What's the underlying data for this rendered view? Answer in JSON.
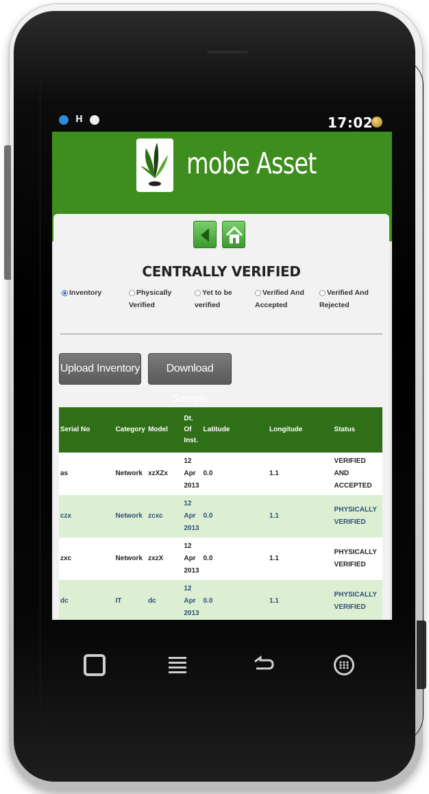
{
  "status_bar": {
    "time": "17:02",
    "icons": [
      "globe-icon",
      "h-signal-icon",
      "notification-icon",
      "battery-icon"
    ]
  },
  "app": {
    "title": "mobe Asset",
    "brand_color": "#3e8e1f"
  },
  "nav": {
    "back_icon": "back-arrow-icon",
    "home_icon": "home-icon"
  },
  "page_title": "CENTRALLY VERIFIED",
  "filters": [
    {
      "label": "Inventory",
      "checked": true
    },
    {
      "label": "Physically Verified",
      "checked": false
    },
    {
      "label": "Yet to be verified",
      "checked": false
    },
    {
      "label": "Verified And Accepted",
      "checked": false
    },
    {
      "label": "Verified And Rejected",
      "checked": false
    }
  ],
  "buttons": {
    "upload": "Upload Inventory",
    "download": "Download Sample"
  },
  "table": {
    "headers": [
      "Serial No",
      "Category",
      "Model",
      "Dt. Of Inst.",
      "Latitude",
      "Longitude",
      "Status"
    ],
    "rows": [
      [
        "as",
        "Network",
        "xzXZx",
        "12 Apr 2013",
        "0.0",
        "1.1",
        "VERIFIED AND ACCEPTED"
      ],
      [
        "czx",
        "Network",
        "zcxc",
        "12 Apr 2013",
        "0.0",
        "1.1",
        "PHYSICALLY VERIFIED"
      ],
      [
        "zxc",
        "Network",
        "zxzX",
        "12 Apr 2013",
        "0.0",
        "1.1",
        "PHYSICALLY VERIFIED"
      ],
      [
        "dc",
        "IT",
        "dc",
        "12 Apr 2013",
        "0.0",
        "1.1",
        "PHYSICALLY VERIFIED"
      ]
    ]
  },
  "hardware_buttons": [
    "recent-apps-icon",
    "menu-icon",
    "back-icon",
    "app-drawer-icon"
  ]
}
